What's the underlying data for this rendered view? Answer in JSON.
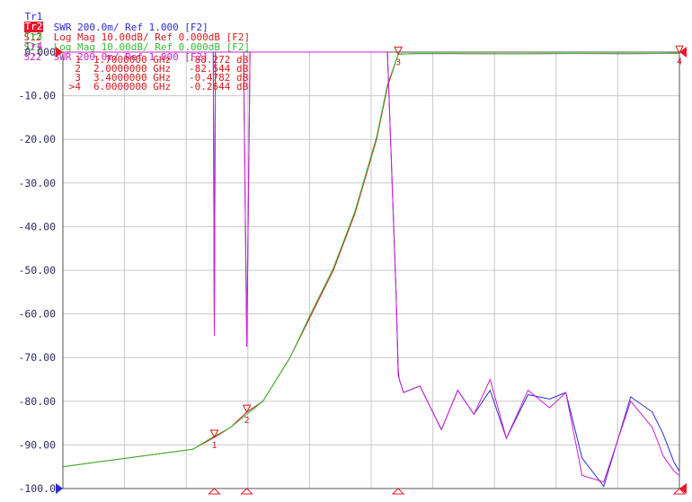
{
  "traces": [
    {
      "tag": "Tr1",
      "text": "S11  SWR 200.0m/ Ref 1.000 [F2]",
      "color": "#2b2bd8",
      "active": false
    },
    {
      "tag": "Tr2",
      "text": "S12  Log Mag 10.00dB/ Ref 0.000dB [F2]",
      "color": "#d51a1a",
      "active": true
    },
    {
      "tag": "Tr3",
      "text": "S21  Log Mag 10.00dB/ Ref 0.000dB [F2]",
      "color": "#2fbf2f",
      "active": false
    },
    {
      "tag": "Tr4",
      "text": "S22  SWR 200.0m/ Ref 1.000 [F2]",
      "color": "#cc22cc",
      "active": false
    }
  ],
  "marker_table": [
    {
      "id": "1",
      "freq": "1.7000000 GHz",
      "value": "-88.272 dB"
    },
    {
      "id": "2",
      "freq": "2.0000000 GHz",
      "value": "-82.544 dB"
    },
    {
      "id": "3",
      "freq": "3.4000000 GHz",
      "value": "-0.4782 dB"
    },
    {
      "id": ">4",
      "freq": "6.0000000 GHz",
      "value": "-0.2644 dB"
    }
  ],
  "colors": {
    "swr_s11": "#2b2bd8",
    "s12": "#d51a1a",
    "s21": "#2fbf2f",
    "swr_s22": "#cc22cc",
    "grid": "#c8c8c8",
    "frame": "#555555",
    "reference": "#e8192c",
    "axis_text": "#2b2b5f"
  },
  "chart_data": {
    "type": "line",
    "title": "",
    "xlabel": "",
    "ylabel": "",
    "x_unit": "GHz",
    "xlim": [
      0.3,
      6.0
    ],
    "ylim": [
      -100,
      0
    ],
    "yticks": [
      "0.000",
      "-10.00",
      "-20.00",
      "-30.00",
      "-40.00",
      "-50.00",
      "-60.00",
      "-70.00",
      "-80.00",
      "-90.00",
      "-100.0"
    ],
    "grid": true,
    "legend": "top-left",
    "series": [
      {
        "name": "Tr1 S11",
        "color": "#2b2bd8",
        "type": "swr",
        "ref": 1.0,
        "scale": 0.2,
        "x": [
          0.3,
          1.6,
          1.69,
          1.7,
          1.71,
          1.75,
          1.9,
          1.97,
          2.0,
          2.03,
          2.1,
          2.8,
          3.3,
          3.38,
          3.4,
          3.41,
          3.45,
          3.6,
          3.8,
          3.95,
          4.1,
          4.25,
          4.4,
          4.6,
          4.8,
          4.95,
          5.1,
          5.3,
          5.55,
          5.75,
          5.85,
          5.95,
          6.0
        ],
        "y": [
          1.0,
          1.0,
          1.0,
          2.3,
          1.0,
          1.0,
          1.0,
          1.0,
          2.35,
          1.0,
          1.0,
          1.0,
          1.0,
          2.1,
          2.48,
          2.5,
          2.56,
          2.53,
          2.73,
          2.55,
          2.66,
          2.55,
          2.77,
          2.57,
          2.59,
          2.56,
          2.86,
          2.99,
          2.58,
          2.65,
          2.75,
          2.88,
          2.92
        ]
      },
      {
        "name": "Tr2 S12",
        "color": "#d51a1a",
        "type": "logmag",
        "x": [
          0.3,
          0.6,
          0.9,
          1.2,
          1.5,
          1.7,
          1.85,
          2.0,
          2.15,
          2.4,
          2.6,
          2.8,
          3.0,
          3.2,
          3.3,
          3.4,
          3.6,
          4.0,
          4.5,
          5.0,
          5.5,
          5.8,
          6.0
        ],
        "y": [
          -95,
          -94,
          -93,
          -92,
          -91,
          -88.3,
          -86,
          -82.5,
          -80,
          -70,
          -60,
          -50,
          -37,
          -20,
          -8,
          -0.48,
          -0.3,
          -0.35,
          -0.4,
          -0.3,
          -0.35,
          -0.3,
          -0.26
        ]
      },
      {
        "name": "Tr3 S21",
        "color": "#2fbf2f",
        "type": "logmag",
        "x": [
          0.3,
          0.6,
          0.9,
          1.2,
          1.5,
          1.7,
          1.85,
          2.0,
          2.15,
          2.4,
          2.6,
          2.8,
          3.0,
          3.2,
          3.3,
          3.4,
          3.6,
          4.0,
          4.5,
          5.0,
          5.5,
          5.8,
          6.0
        ],
        "y": [
          -95,
          -94,
          -93,
          -92,
          -91,
          -88,
          -86,
          -83,
          -80,
          -70,
          -59.5,
          -49.5,
          -36.5,
          -19.5,
          -7.5,
          -0.5,
          -0.3,
          -0.35,
          -0.4,
          -0.3,
          -0.35,
          -0.3,
          -0.28
        ]
      },
      {
        "name": "Tr4 S22",
        "color": "#cc22cc",
        "type": "swr",
        "ref": 1.0,
        "scale": 0.2,
        "x": [
          0.3,
          1.6,
          1.69,
          1.7,
          1.71,
          1.75,
          1.9,
          1.97,
          2.0,
          2.03,
          2.1,
          2.8,
          3.3,
          3.38,
          3.4,
          3.41,
          3.45,
          3.6,
          3.8,
          3.95,
          4.1,
          4.25,
          4.4,
          4.6,
          4.8,
          4.95,
          5.1,
          5.3,
          5.55,
          5.75,
          5.85,
          5.95,
          6.0
        ],
        "y": [
          1.0,
          1.0,
          1.0,
          2.3,
          1.0,
          1.0,
          1.0,
          1.0,
          2.35,
          1.0,
          1.0,
          1.0,
          1.0,
          2.1,
          2.45,
          2.5,
          2.56,
          2.53,
          2.73,
          2.55,
          2.66,
          2.5,
          2.77,
          2.55,
          2.63,
          2.56,
          2.94,
          2.97,
          2.6,
          2.72,
          2.85,
          2.92,
          2.94
        ]
      }
    ],
    "markers": [
      {
        "id": "1",
        "x": 1.7,
        "y": -88.272
      },
      {
        "id": "2",
        "x": 2.0,
        "y": -82.544
      },
      {
        "id": "3",
        "x": 3.4,
        "y": -0.4782
      },
      {
        "id": "4",
        "x": 6.0,
        "y": -0.2644
      }
    ]
  }
}
